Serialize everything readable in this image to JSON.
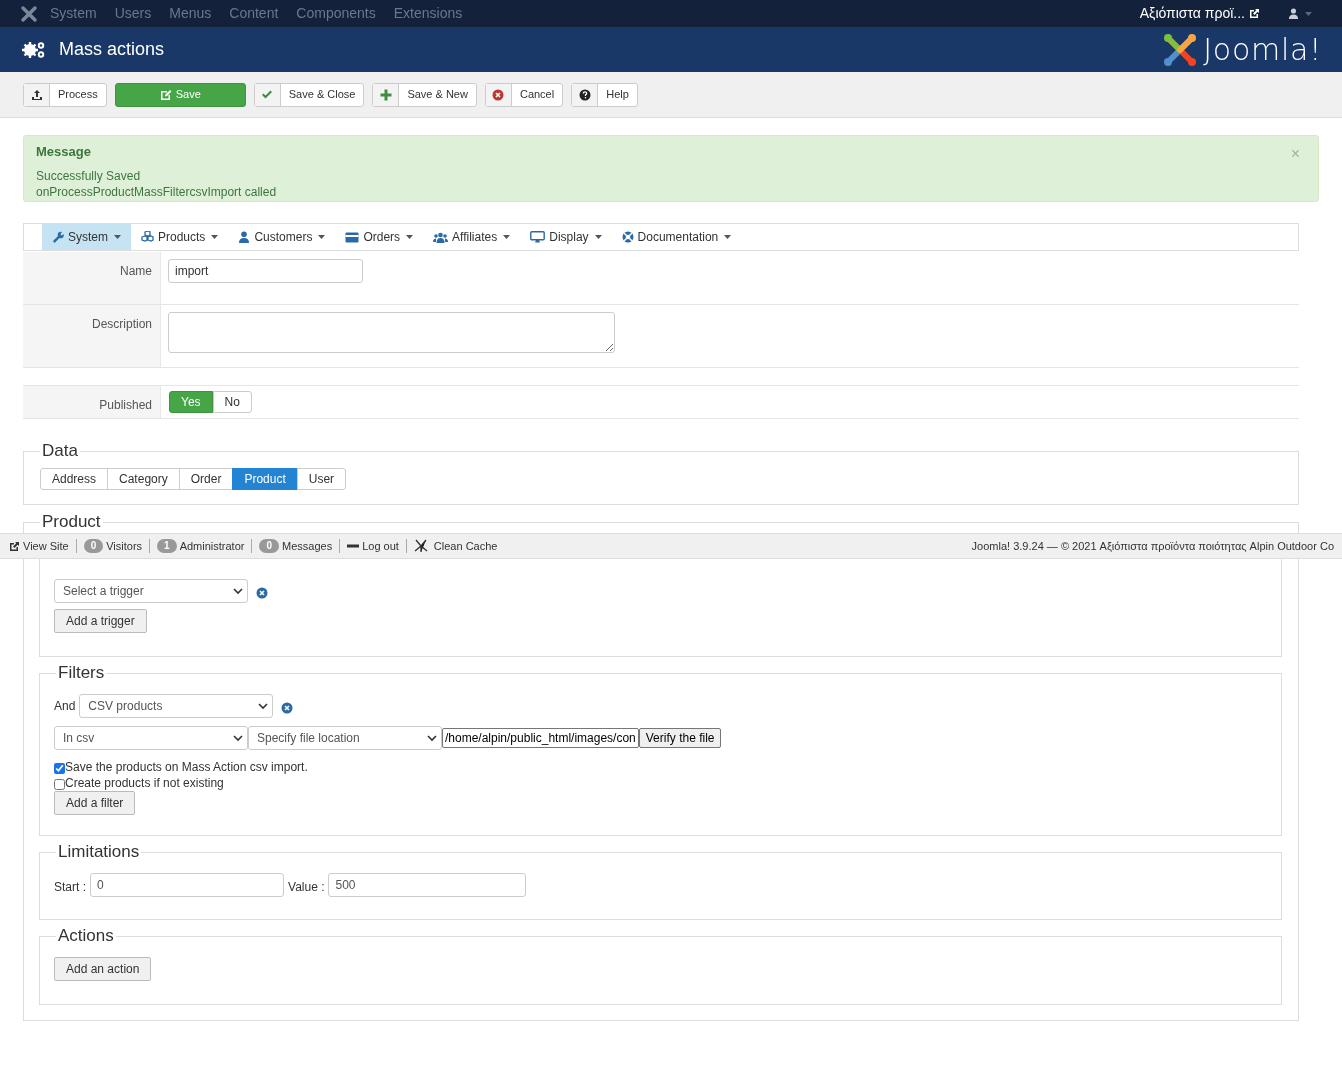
{
  "top_menu": {
    "items": [
      "System",
      "Users",
      "Menus",
      "Content",
      "Components",
      "Extensions"
    ],
    "site_link": "Αξιόπιστα προϊ..."
  },
  "header": {
    "title": "Mass actions",
    "logo_text": "Joomla!"
  },
  "toolbar": [
    {
      "label": "Process",
      "kind": "upload"
    },
    {
      "label": "Save",
      "kind": "primary"
    },
    {
      "label": "Save & Close",
      "kind": "check"
    },
    {
      "label": "Save & New",
      "kind": "plus"
    },
    {
      "label": "Cancel",
      "kind": "cancel"
    },
    {
      "label": "Help",
      "kind": "help"
    }
  ],
  "message": {
    "heading": "Message",
    "lines": [
      "Successfully Saved",
      "onProcessProductMassFiltercsvImport called"
    ],
    "close": "×"
  },
  "menu_tabs": [
    {
      "label": "System",
      "selected": true
    },
    {
      "label": "Products",
      "selected": false
    },
    {
      "label": "Customers",
      "selected": false
    },
    {
      "label": "Orders",
      "selected": false
    },
    {
      "label": "Affiliates",
      "selected": false
    },
    {
      "label": "Display",
      "selected": false
    },
    {
      "label": "Documentation",
      "selected": false
    }
  ],
  "form": {
    "name": {
      "label": "Name",
      "value": "import"
    },
    "description": {
      "label": "Description"
    },
    "published": {
      "label": "Published",
      "options": [
        {
          "label": "Yes",
          "selected": true
        },
        {
          "label": "No",
          "selected": false
        }
      ]
    }
  },
  "data": {
    "legend": "Data",
    "tabs": [
      {
        "label": "Address",
        "selected": false
      },
      {
        "label": "Category",
        "selected": false
      },
      {
        "label": "Order",
        "selected": false
      },
      {
        "label": "Product",
        "selected": true
      },
      {
        "label": "User",
        "selected": false
      }
    ]
  },
  "product": {
    "legend": "Product",
    "triggers": {
      "select": "Select a trigger",
      "add": "Add a trigger"
    },
    "filters": {
      "legend": "Filters",
      "conjunction": "And",
      "filter_type": "CSV products",
      "column": "In csv",
      "source": "Specify file location",
      "path": "/home/alpin/public_html/images/con",
      "verify": "Verify the file",
      "options": [
        {
          "label": "Save the products on Mass Action csv import.",
          "checked": true
        },
        {
          "label": "Create products if not existing",
          "checked": false
        }
      ],
      "add": "Add a filter"
    },
    "limitations": {
      "legend": "Limitations",
      "start_label": "Start :",
      "start_value": "0",
      "value_label": "Value :",
      "value_value": "500"
    },
    "actions": {
      "legend": "Actions",
      "add": "Add an action"
    }
  },
  "status_bar": {
    "items": [
      {
        "kind": "link",
        "label": "View Site"
      },
      {
        "kind": "badge",
        "count": "0",
        "label": "Visitors"
      },
      {
        "kind": "badge",
        "count": "1",
        "label": "Administrator"
      },
      {
        "kind": "badge",
        "count": "0",
        "label": "Messages"
      },
      {
        "kind": "logout",
        "label": "Log out"
      },
      {
        "kind": "cache",
        "label": "Clean Cache"
      }
    ],
    "copyright": "Joomla! 3.9.24 — © 2021 Αξιόπιστα προϊόντα ποιότητας Alpin Outdoor Co"
  }
}
